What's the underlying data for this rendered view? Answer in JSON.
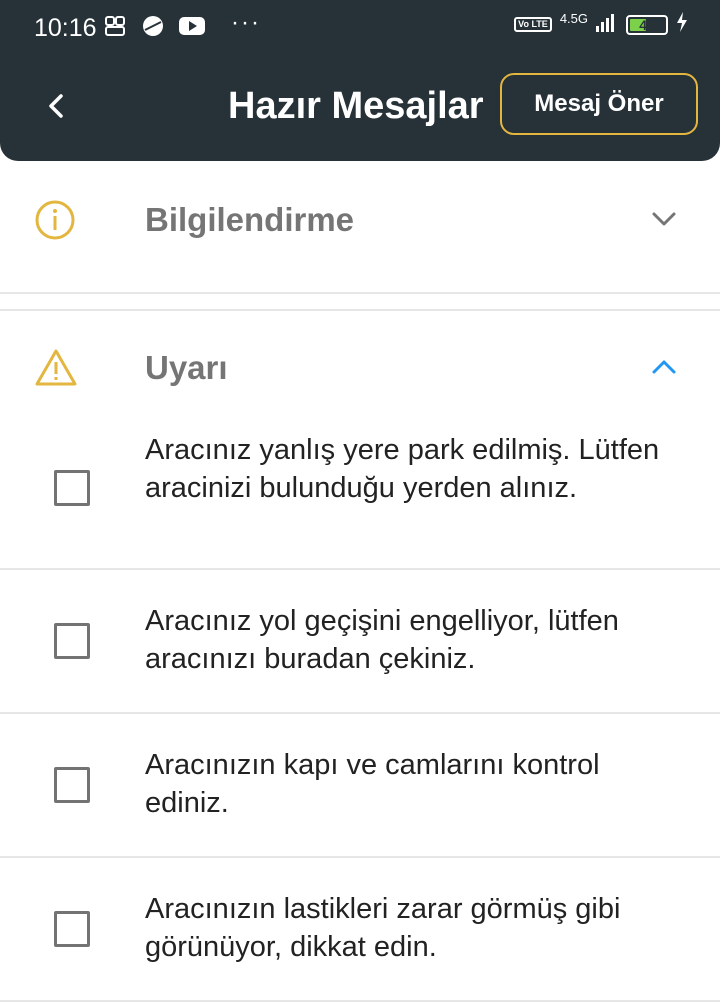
{
  "status_bar": {
    "time": "10:16",
    "icons_left": [
      "game-icon",
      "dribbble-icon",
      "youtube-icon"
    ],
    "more": "···",
    "volte": "Vo LTE",
    "network": "4.5G",
    "battery_level": "42"
  },
  "header": {
    "title": "Hazır Mesajlar",
    "suggest_button": "Mesaj Öner",
    "accent_color": "#e3b640",
    "background_color": "#263238"
  },
  "sections": [
    {
      "title": "Bilgilendirme",
      "icon": "info-icon",
      "expanded": false,
      "messages": []
    },
    {
      "title": "Uyarı",
      "icon": "warning-icon",
      "expanded": true,
      "messages": [
        {
          "text": "Aracınız yanlış yere park edilmiş. Lütfen aracinizi bulunduğu yerden alınız.",
          "checked": false
        },
        {
          "text": "Aracınız yol geçişini engelliyor, lütfen aracınızı buradan çekiniz.",
          "checked": false
        },
        {
          "text": "Aracınızın kapı ve camlarını kontrol ediniz.",
          "checked": false
        },
        {
          "text": "Aracınızın lastikleri zarar görmüş gibi görünüyor, dikkat edin.",
          "checked": false
        }
      ]
    }
  ]
}
